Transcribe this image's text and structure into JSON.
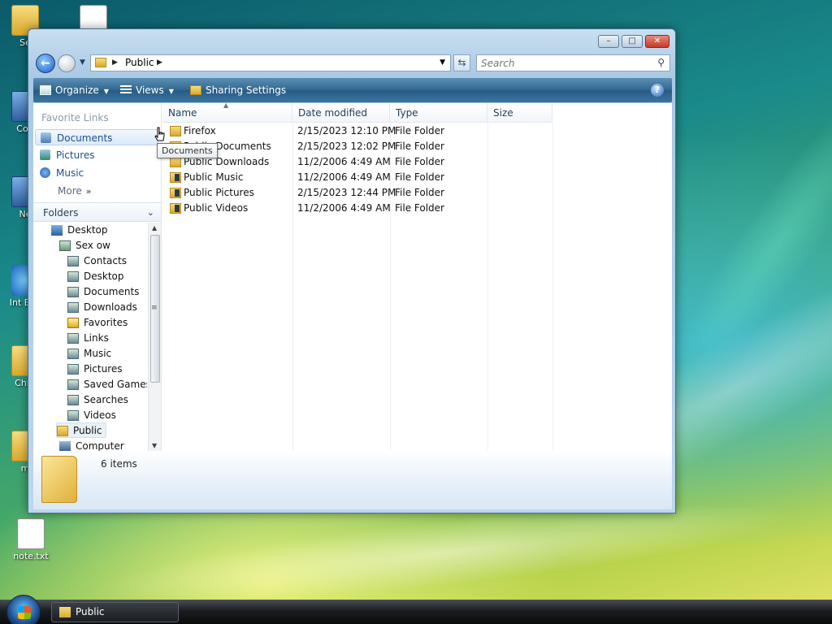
{
  "desktop": {
    "icons": [
      {
        "label": "Se",
        "kind": "folder"
      },
      {
        "label": "Con",
        "kind": "pc"
      },
      {
        "label": "Ne",
        "kind": "pc"
      },
      {
        "label": "Int Exp",
        "kind": "ie"
      },
      {
        "label": "Chro",
        "kind": "folder"
      },
      {
        "label": "m",
        "kind": "folder"
      },
      {
        "label": "note.txt",
        "kind": "doc"
      }
    ]
  },
  "window": {
    "address": {
      "current": "Public"
    },
    "search": {
      "placeholder": "Search"
    },
    "toolbar": {
      "organize": "Organize",
      "views": "Views",
      "sharing": "Sharing Settings",
      "help": "?"
    },
    "favorites": {
      "title": "Favorite Links",
      "items": [
        "Documents",
        "Pictures",
        "Music"
      ],
      "more": "More"
    },
    "folders": {
      "title": "Folders",
      "tree": [
        {
          "label": "Desktop",
          "level": 0,
          "icon": "desktop"
        },
        {
          "label": "Sex ow",
          "level": 1,
          "icon": "user"
        },
        {
          "label": "Contacts",
          "level": 2,
          "icon": "folder"
        },
        {
          "label": "Desktop",
          "level": 2,
          "icon": "folder"
        },
        {
          "label": "Documents",
          "level": 2,
          "icon": "folder"
        },
        {
          "label": "Downloads",
          "level": 2,
          "icon": "folder"
        },
        {
          "label": "Favorites",
          "level": 2,
          "icon": "star"
        },
        {
          "label": "Links",
          "level": 2,
          "icon": "folder"
        },
        {
          "label": "Music",
          "level": 2,
          "icon": "folder"
        },
        {
          "label": "Pictures",
          "level": 2,
          "icon": "folder"
        },
        {
          "label": "Saved Games",
          "level": 2,
          "icon": "folder"
        },
        {
          "label": "Searches",
          "level": 2,
          "icon": "folder"
        },
        {
          "label": "Videos",
          "level": 2,
          "icon": "folder"
        },
        {
          "label": "Public",
          "level": 1,
          "icon": "public",
          "selected": true
        },
        {
          "label": "Computer",
          "level": 1,
          "icon": "computer"
        }
      ]
    },
    "columns": [
      "Name",
      "Date modified",
      "Type",
      "Size"
    ],
    "files": [
      {
        "name": "Firefox",
        "date": "2/15/2023 12:10 PM",
        "type": "File Folder",
        "overlay": false
      },
      {
        "name": "Public Documents",
        "date": "2/15/2023 12:02 PM",
        "type": "File Folder",
        "overlay": false
      },
      {
        "name": "Public Downloads",
        "date": "11/2/2006 4:49 AM",
        "type": "File Folder",
        "overlay": false
      },
      {
        "name": "Public Music",
        "date": "11/2/2006 4:49 AM",
        "type": "File Folder",
        "overlay": true
      },
      {
        "name": "Public Pictures",
        "date": "2/15/2023 12:44 PM",
        "type": "File Folder",
        "overlay": true
      },
      {
        "name": "Public Videos",
        "date": "11/2/2006 4:49 AM",
        "type": "File Folder",
        "overlay": true
      }
    ],
    "tooltip": "Documents",
    "details": {
      "count": "6 items"
    }
  },
  "taskbar": {
    "task": "Public"
  },
  "colors": {
    "link_blue": "#1e4e9a",
    "toolbar_blue": "#2f6690",
    "close_red": "#c4392a"
  }
}
